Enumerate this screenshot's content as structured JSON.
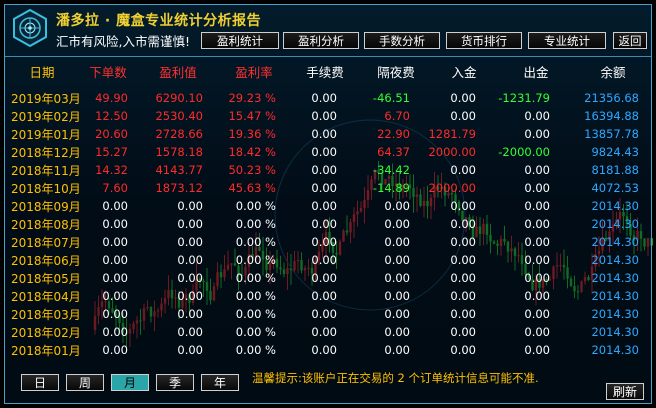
{
  "header": {
    "title": "潘多拉 · 魔盒专业统计分析报告",
    "warning": "汇市有风险,入市需谨慎!"
  },
  "tabs": [
    {
      "label": "盈利统计"
    },
    {
      "label": "盈利分析"
    },
    {
      "label": "手数分析"
    },
    {
      "label": "货币排行"
    },
    {
      "label": "专业统计"
    },
    {
      "label": "返回"
    }
  ],
  "columns": [
    "日期",
    "下单数",
    "盈利值",
    "盈利率",
    "手续费",
    "隔夜费",
    "入金",
    "出金",
    "余额"
  ],
  "column_colors": {
    "date": "#ffc000",
    "orders": "#ff3030",
    "profit": "#ff3030",
    "rate": "#ff3030",
    "fee": "#ffffff",
    "swap": "#ffffff",
    "deposit": "#ffffff",
    "withdraw": "#ffffff",
    "balance": "#ffffff"
  },
  "rows": [
    {
      "date": "2019年03月",
      "orders": "49.90",
      "profit": "6290.10",
      "rate": "29.23 %",
      "fee": "0.00",
      "swap": "-46.51",
      "deposit": "0.00",
      "withdraw": "-1231.79",
      "balance": "21356.68"
    },
    {
      "date": "2019年02月",
      "orders": "12.50",
      "profit": "2530.40",
      "rate": "15.47 %",
      "fee": "0.00",
      "swap": "6.70",
      "deposit": "0.00",
      "withdraw": "0.00",
      "balance": "16394.88"
    },
    {
      "date": "2019年01月",
      "orders": "20.60",
      "profit": "2728.66",
      "rate": "19.36 %",
      "fee": "0.00",
      "swap": "22.90",
      "deposit": "1281.79",
      "withdraw": "0.00",
      "balance": "13857.78"
    },
    {
      "date": "2018年12月",
      "orders": "15.27",
      "profit": "1578.18",
      "rate": "18.42 %",
      "fee": "0.00",
      "swap": "64.37",
      "deposit": "2000.00",
      "withdraw": "-2000.00",
      "balance": "9824.43"
    },
    {
      "date": "2018年11月",
      "orders": "14.32",
      "profit": "4143.77",
      "rate": "50.23 %",
      "fee": "0.00",
      "swap": "-34.42",
      "deposit": "0.00",
      "withdraw": "0.00",
      "balance": "8181.88"
    },
    {
      "date": "2018年10月",
      "orders": "7.60",
      "profit": "1873.12",
      "rate": "45.63 %",
      "fee": "0.00",
      "swap": "-14.89",
      "deposit": "2000.00",
      "withdraw": "0.00",
      "balance": "4072.53"
    },
    {
      "date": "2018年09月",
      "orders": "0.00",
      "profit": "0.00",
      "rate": "0.00 %",
      "fee": "0.00",
      "swap": "0.00",
      "deposit": "0.00",
      "withdraw": "0.00",
      "balance": "2014.30"
    },
    {
      "date": "2018年08月",
      "orders": "0.00",
      "profit": "0.00",
      "rate": "0.00 %",
      "fee": "0.00",
      "swap": "0.00",
      "deposit": "0.00",
      "withdraw": "0.00",
      "balance": "2014.30"
    },
    {
      "date": "2018年07月",
      "orders": "0.00",
      "profit": "0.00",
      "rate": "0.00 %",
      "fee": "0.00",
      "swap": "0.00",
      "deposit": "0.00",
      "withdraw": "0.00",
      "balance": "2014.30"
    },
    {
      "date": "2018年06月",
      "orders": "0.00",
      "profit": "0.00",
      "rate": "0.00 %",
      "fee": "0.00",
      "swap": "0.00",
      "deposit": "0.00",
      "withdraw": "0.00",
      "balance": "2014.30"
    },
    {
      "date": "2018年05月",
      "orders": "0.00",
      "profit": "0.00",
      "rate": "0.00 %",
      "fee": "0.00",
      "swap": "0.00",
      "deposit": "0.00",
      "withdraw": "0.00",
      "balance": "2014.30"
    },
    {
      "date": "2018年04月",
      "orders": "0.00",
      "profit": "0.00",
      "rate": "0.00 %",
      "fee": "0.00",
      "swap": "0.00",
      "deposit": "0.00",
      "withdraw": "0.00",
      "balance": "2014.30"
    },
    {
      "date": "2018年03月",
      "orders": "0.00",
      "profit": "0.00",
      "rate": "0.00 %",
      "fee": "0.00",
      "swap": "0.00",
      "deposit": "0.00",
      "withdraw": "0.00",
      "balance": "2014.30"
    },
    {
      "date": "2018年02月",
      "orders": "0.00",
      "profit": "0.00",
      "rate": "0.00 %",
      "fee": "0.00",
      "swap": "0.00",
      "deposit": "0.00",
      "withdraw": "0.00",
      "balance": "2014.30"
    },
    {
      "date": "2018年01月",
      "orders": "0.00",
      "profit": "0.00",
      "rate": "0.00 %",
      "fee": "0.00",
      "swap": "0.00",
      "deposit": "0.00",
      "withdraw": "0.00",
      "balance": "2014.30"
    }
  ],
  "periods": [
    {
      "label": "日"
    },
    {
      "label": "周"
    },
    {
      "label": "月",
      "active": true
    },
    {
      "label": "季"
    },
    {
      "label": "年"
    }
  ],
  "tip": "温馨提示:该账户正在交易的 2 个订单统计信息可能不准.",
  "refresh_label": "刷新",
  "colors": {
    "title": "#f0d030",
    "date": "#ffc000",
    "red": "#ff2a2a",
    "green": "#33ff33",
    "blue": "#2ea8ff",
    "border": "#4aa0c8",
    "active_tab": "#2aa6a8",
    "candle_up": "#ff2020",
    "candle_down": "#22dd22"
  },
  "icons": {
    "logo": "pandora-hexagon-logo-icon"
  }
}
